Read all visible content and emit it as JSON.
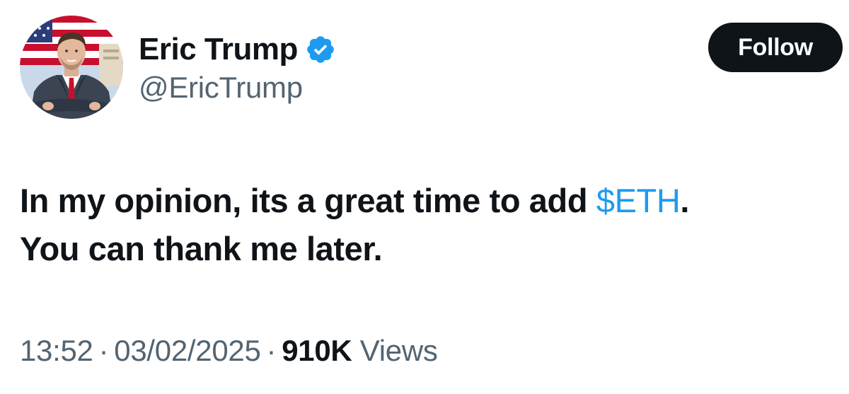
{
  "author": {
    "display_name": "Eric Trump",
    "handle": "@EricTrump",
    "verified_icon": "verified-badge-icon",
    "verified_color": "#1d9bf0",
    "avatar_icon": "profile-photo"
  },
  "actions": {
    "follow_label": "Follow"
  },
  "tweet": {
    "text_before": "In my opinion, its a great time to add ",
    "cashtag": "$ETH",
    "text_after_cashtag": ".",
    "line2": "You can thank me later."
  },
  "meta": {
    "time": "13:52",
    "separator": "·",
    "date": "03/02/2025",
    "views_count": "910K",
    "views_label": "Views"
  },
  "colors": {
    "text_primary": "#0f1419",
    "text_secondary": "#536471",
    "link": "#1d9bf0",
    "follow_bg": "#0f1419"
  }
}
